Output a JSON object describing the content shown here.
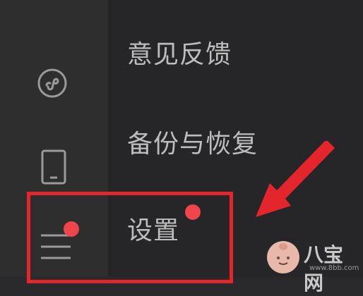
{
  "menu": {
    "items": [
      {
        "label": "意见反馈"
      },
      {
        "label": "备份与恢复"
      },
      {
        "label": "设置"
      }
    ]
  },
  "sidebar": {
    "icons": [
      "mini-program-icon",
      "phone-icon",
      "hamburger-menu-icon"
    ]
  },
  "watermark": {
    "brand": "八宝网",
    "url": "www.8bb.com"
  },
  "colors": {
    "highlight": "#e5252c",
    "badge": "#f0454a",
    "text": "#bdbdbd"
  }
}
